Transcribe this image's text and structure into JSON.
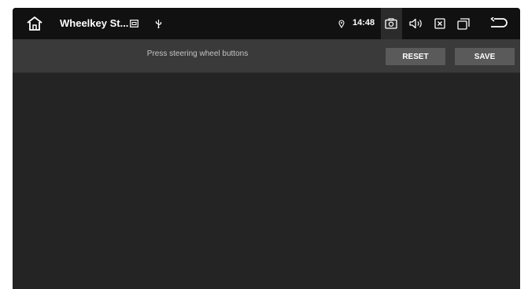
{
  "status_bar": {
    "app_title": "Wheelkey St...",
    "time": "14:48",
    "icons": [
      "home-icon",
      "media-app-icon",
      "usb-icon",
      "location-icon",
      "screenshot-icon",
      "volume-icon",
      "close-app-icon",
      "recent-apps-icon",
      "back-icon"
    ]
  },
  "toolbar": {
    "prompt": "Press steering wheel buttons",
    "reset_label": "RESET",
    "save_label": "SAVE"
  },
  "colors": {
    "status_bar_bg": "#111111",
    "toolbar_bg": "#3a3a3a",
    "content_bg": "#242424",
    "button_bg": "#5a5a5a"
  }
}
